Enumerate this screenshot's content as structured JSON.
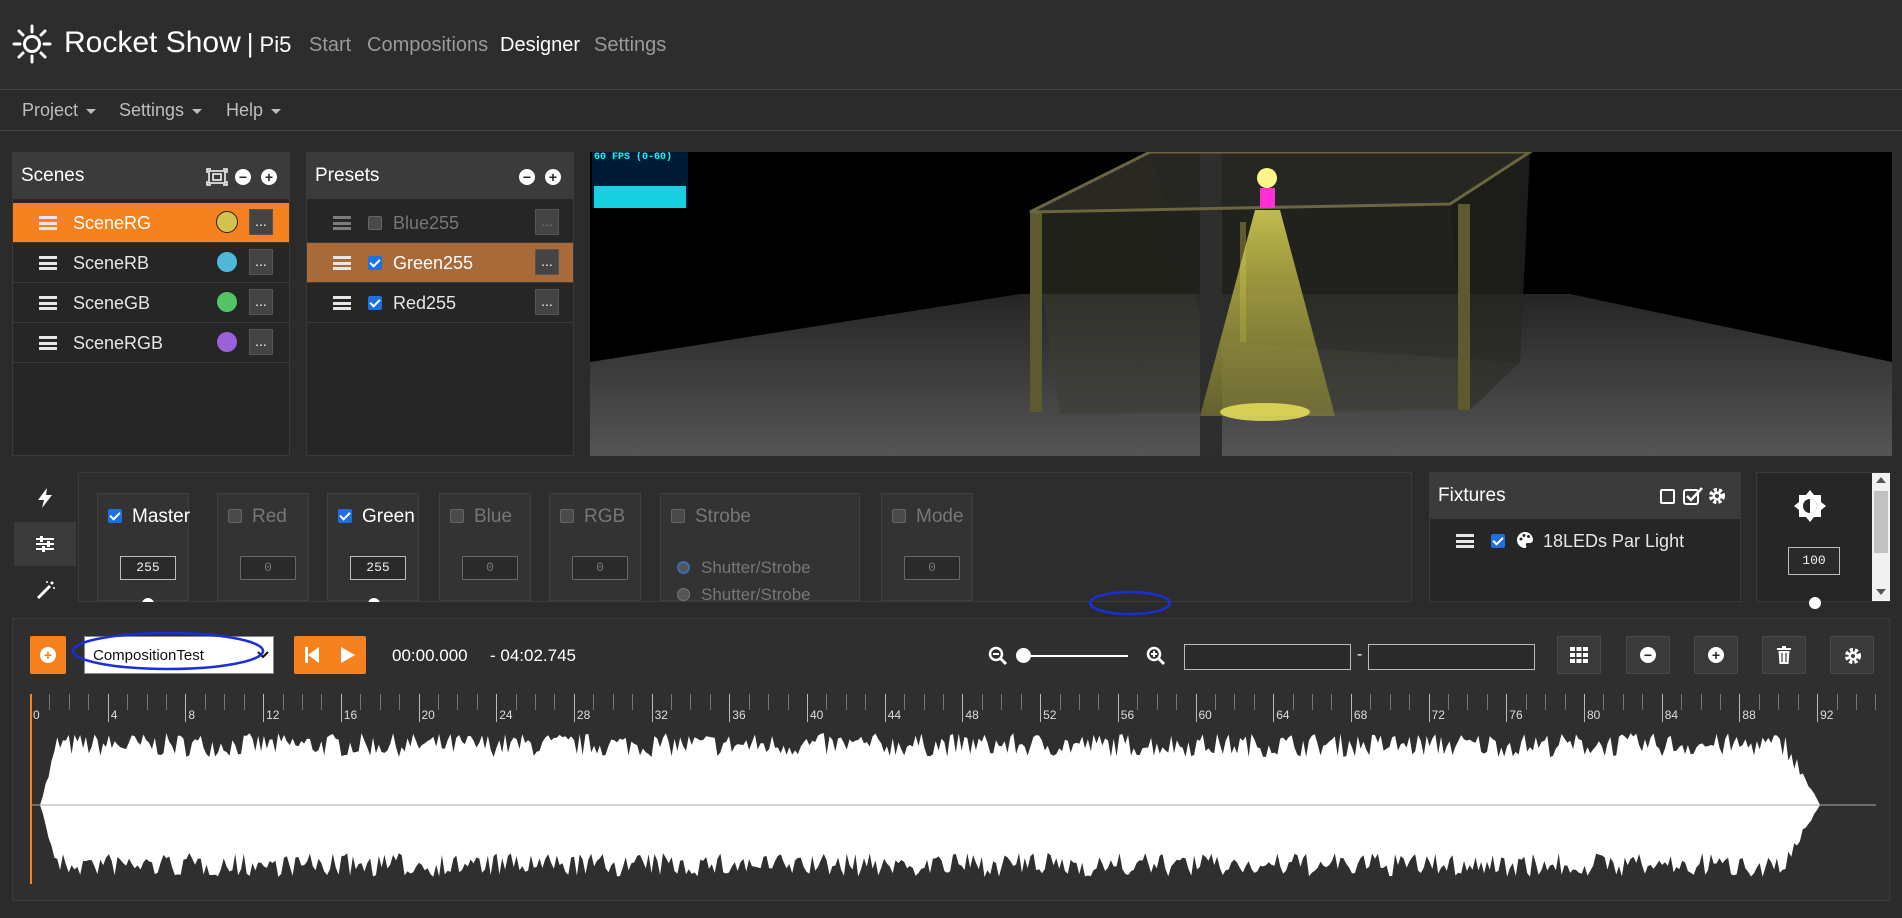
{
  "app": {
    "name": "Rocket Show",
    "device": "Pi5"
  },
  "nav": [
    {
      "label": "Start",
      "active": false
    },
    {
      "label": "Compositions",
      "active": false
    },
    {
      "label": "Designer",
      "active": true
    },
    {
      "label": "Settings",
      "active": false
    }
  ],
  "menubar": [
    {
      "label": "Project"
    },
    {
      "label": "Settings"
    },
    {
      "label": "Help"
    }
  ],
  "scenes": {
    "title": "Scenes",
    "items": [
      {
        "label": "SceneRG",
        "color": "#d4c24f",
        "selected": true,
        "more": "..."
      },
      {
        "label": "SceneRB",
        "color": "#4fb8d8",
        "selected": false,
        "more": "..."
      },
      {
        "label": "SceneGB",
        "color": "#52c464",
        "selected": false,
        "more": "..."
      },
      {
        "label": "SceneRGB",
        "color": "#9a62d8",
        "selected": false,
        "more": "..."
      }
    ]
  },
  "presets": {
    "title": "Presets",
    "items": [
      {
        "label": "Blue255",
        "checked": false,
        "selected": false,
        "more": "..."
      },
      {
        "label": "Green255",
        "checked": true,
        "selected": true,
        "more": "..."
      },
      {
        "label": "Red255",
        "checked": true,
        "selected": false,
        "more": "..."
      }
    ]
  },
  "viewport": {
    "fps_label": "60 FPS (0-60)"
  },
  "channels": [
    {
      "label": "Master",
      "checked": true,
      "value": "255"
    },
    {
      "label": "Red",
      "checked": false,
      "value": "0"
    },
    {
      "label": "Green",
      "checked": true,
      "value": "255"
    },
    {
      "label": "Blue",
      "checked": false,
      "value": "0"
    },
    {
      "label": "RGB",
      "checked": false,
      "value": "0"
    },
    {
      "label": "Strobe",
      "checked": false,
      "options": [
        "Shutter/Strobe",
        "Shutter/Strobe"
      ]
    },
    {
      "label": "Mode",
      "checked": false,
      "value": "0"
    }
  ],
  "fixtures": {
    "title": "Fixtures",
    "items": [
      {
        "label": "18LEDs Par Light",
        "checked": true
      }
    ]
  },
  "brightness": {
    "value": "100"
  },
  "transport": {
    "composition": "CompositionTest",
    "position": "00:00.000",
    "duration": "- 04:02.745",
    "range_separator": "-",
    "range_from": "",
    "range_to": ""
  },
  "timeline": {
    "ticks": [
      "0",
      "4",
      "8",
      "12",
      "16",
      "20",
      "24",
      "28",
      "32",
      "36",
      "40",
      "44",
      "48",
      "52",
      "56",
      "60",
      "64",
      "68",
      "72",
      "76",
      "80",
      "84",
      "88",
      "92"
    ]
  },
  "colors": {
    "accent": "#f5821f",
    "selected_preset": "#a96a3a",
    "checkbox": "#1e6fe0"
  }
}
